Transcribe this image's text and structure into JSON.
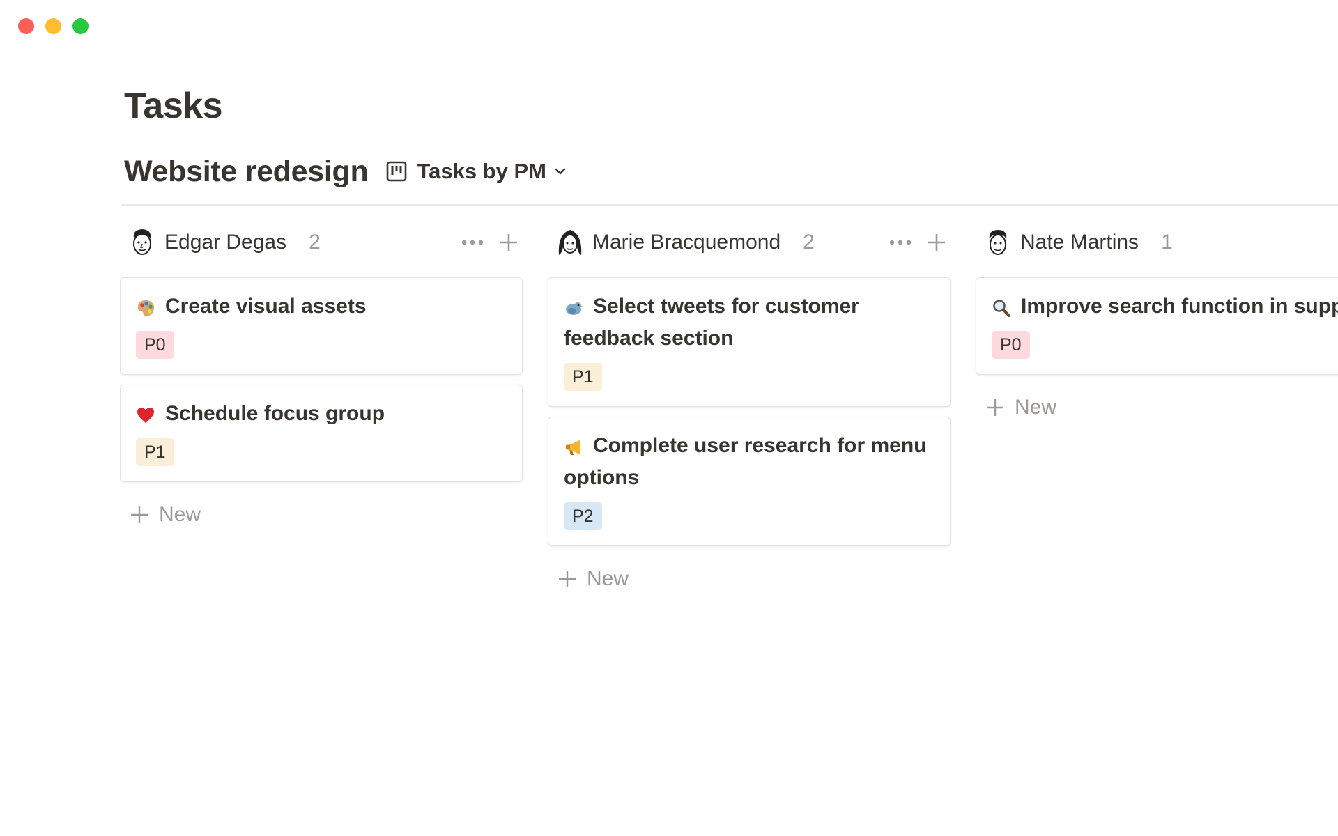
{
  "window": {
    "controls": {
      "close_color": "#ff5f57",
      "minimize_color": "#febc2e",
      "maximize_color": "#28c840"
    }
  },
  "page": {
    "title": "Tasks"
  },
  "database": {
    "title": "Website redesign",
    "view": {
      "label": "Tasks by PM",
      "icon": "board-view-icon"
    }
  },
  "columns": [
    {
      "name": "Edgar Degas",
      "count": "2",
      "avatar": "avatar-edgar-icon",
      "cards": [
        {
          "emoji": "palette-icon",
          "title": "Create visual assets",
          "tag": "P0"
        },
        {
          "emoji": "heart-icon",
          "title": "Schedule focus group",
          "tag": "P1"
        }
      ],
      "new_label": "New"
    },
    {
      "name": "Marie Bracquemond",
      "count": "2",
      "avatar": "avatar-marie-icon",
      "cards": [
        {
          "emoji": "bird-icon",
          "title": "Select tweets for customer feedback section",
          "tag": "P1"
        },
        {
          "emoji": "megaphone-icon",
          "title": "Complete user research for menu options",
          "tag": "P2"
        }
      ],
      "new_label": "New"
    },
    {
      "name": "Nate Martins",
      "count": "1",
      "avatar": "avatar-nate-icon",
      "cards": [
        {
          "emoji": "magnifier-icon",
          "title": "Improve search function in suppo",
          "tag": "P0"
        }
      ],
      "new_label": "New"
    }
  ],
  "tag_colors": {
    "P0": "#ffd9dd",
    "P1": "#fbefd9",
    "P2": "#d6e8f6"
  },
  "text_color": "#37352f",
  "muted_color": "#9b9a97"
}
